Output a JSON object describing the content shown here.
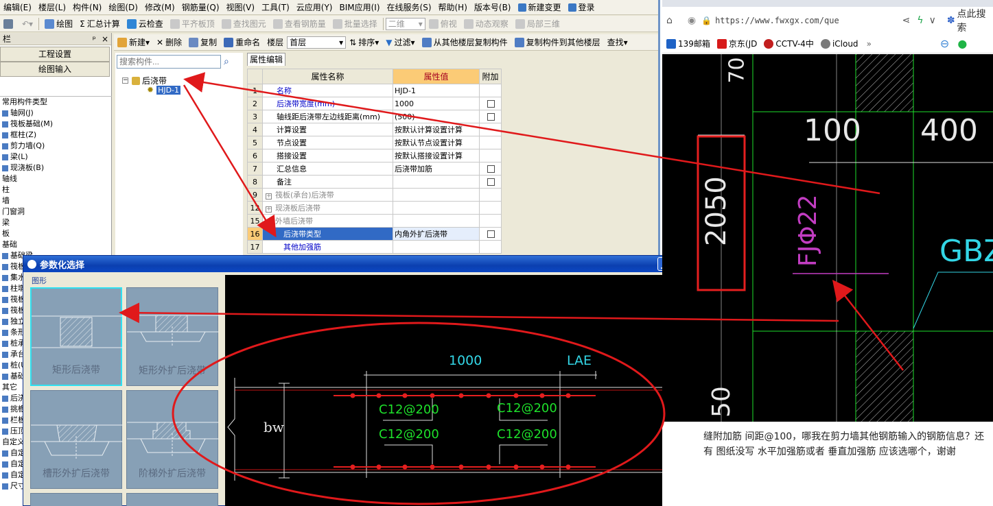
{
  "menu": [
    "编辑(E)",
    "楼层(L)",
    "构件(N)",
    "绘图(D)",
    "修改(M)",
    "钢筋量(Q)",
    "视图(V)",
    "工具(T)",
    "云应用(Y)",
    "BIM应用(I)",
    "在线服务(S)",
    "帮助(H)",
    "版本号(B)",
    "新建变更",
    "登录"
  ],
  "toolbar1": {
    "draw": "绘图",
    "sum": "汇总计算",
    "cloud_check": "云检查",
    "flat_slab": "平齐板顶",
    "find_elem": "查找图元",
    "view_rebar": "查看钢筋量",
    "batch_select": "批量选择",
    "view_mode": "二维",
    "top_view": "俯视",
    "dynamic_view": "动态观察",
    "local_3d": "局部三维"
  },
  "toolbar2": {
    "new": "新建",
    "delete": "删除",
    "copy": "复制",
    "rename": "重命名",
    "floor_label": "楼层",
    "floor_value": "首层",
    "sort": "排序",
    "filter": "过滤",
    "copy_from": "从其他楼层复制构件",
    "copy_to": "复制构件到其他楼层",
    "find": "查找"
  },
  "dock": {
    "title": "栏",
    "pin": "ᵖ",
    "close": "×",
    "btn_settings": "工程设置",
    "btn_draw_input": "绘图输入",
    "tree": [
      "常用构件类型",
      "轴网(J)",
      "筏板基础(M)",
      "框柱(Z)",
      "剪力墙(Q)",
      "梁(L)",
      "现浇板(B)",
      "轴线",
      "柱",
      "墙",
      "门窗洞",
      "梁",
      "板",
      "基础",
      "基础梁",
      "筏板",
      "集水",
      "柱墩",
      "筏板",
      "筏板",
      "独立",
      "条形",
      "桩承",
      "承台",
      "桩(U)",
      "基础",
      "其它",
      "后浇",
      "挑檐",
      "栏板",
      "压顶",
      "自定义",
      "自定",
      "自定",
      "自定",
      "尺寸"
    ]
  },
  "comp_tree": {
    "search_placeholder": "搜索构件...",
    "root": "后浇带",
    "child": "HJD-1"
  },
  "props": {
    "tab": "属性编辑",
    "headers": [
      "属性名称",
      "属性值",
      "附加"
    ],
    "rows": [
      {
        "no": "1",
        "name": "名称",
        "value": "HJD-1",
        "style": "blue",
        "cb": false
      },
      {
        "no": "2",
        "name": "后浇带宽度(mm)",
        "value": "1000",
        "style": "blue",
        "cb": true
      },
      {
        "no": "3",
        "name": "轴线距后浇带左边线距离(mm)",
        "value": "(500)",
        "style": "",
        "cb": true
      },
      {
        "no": "4",
        "name": "计算设置",
        "value": "按默认计算设置计算",
        "style": "",
        "cb": false
      },
      {
        "no": "5",
        "name": "节点设置",
        "value": "按默认节点设置计算",
        "style": "",
        "cb": false
      },
      {
        "no": "6",
        "name": "搭接设置",
        "value": "按默认搭接设置计算",
        "style": "",
        "cb": false
      },
      {
        "no": "7",
        "name": "汇总信息",
        "value": "后浇带加筋",
        "style": "",
        "cb": true
      },
      {
        "no": "8",
        "name": "备注",
        "value": "",
        "style": "",
        "cb": true
      },
      {
        "no": "9",
        "name": "筏板(承台)后浇带",
        "value": "",
        "style": "grey",
        "cb": false,
        "expand": "+"
      },
      {
        "no": "12",
        "name": "现浇板后浇带",
        "value": "",
        "style": "grey",
        "cb": false,
        "expand": "+"
      },
      {
        "no": "15",
        "name": "外墙后浇带",
        "value": "",
        "style": "grey",
        "cb": false,
        "expand": "−"
      },
      {
        "no": "16",
        "name": "后浇带类型",
        "value": "内角外扩后浇带",
        "style": "sel",
        "cb": true
      },
      {
        "no": "17",
        "name": "其他加强筋",
        "value": "",
        "style": "blue",
        "cb": false
      }
    ]
  },
  "dialog": {
    "title": "参数化选择",
    "shape_label": "图形",
    "tiles": [
      "矩形后浇带",
      "矩形外扩后浇带",
      "槽形外扩后浇带",
      "阶梯外扩后浇带"
    ],
    "canvas": {
      "dim_width": "1000",
      "dim_lae": "LAE",
      "bw": "bw",
      "rebar": [
        "C12@200",
        "C12@200",
        "C12@200",
        "C12@200"
      ]
    }
  },
  "browser": {
    "url": "https://www.fwxgx.com/que",
    "search_engine": "点此搜索",
    "bookmarks": [
      "139邮箱",
      "京东(JD",
      "CCTV-4中",
      "iCloud"
    ],
    "cad": {
      "d100": "100",
      "d400": "400",
      "d2050": "2050",
      "fj": "FJΦ22",
      "gbz": "GBZ",
      "top": "70",
      "bottom": "50"
    },
    "question": "缝附加筋 间距@100，哪我在剪力墙其他钢筋输入的钢筋信息？还有 图纸没写 水平加强筋或者 垂直加强筋 应该选哪个，谢谢"
  },
  "colors": {
    "accent": "#316ac5",
    "title_bar": "#0b3fb0",
    "annotation": "#e0191b",
    "cad_green": "#1ee12b",
    "cad_magenta": "#c23dc2",
    "cad_cyan": "#33d6e6"
  }
}
